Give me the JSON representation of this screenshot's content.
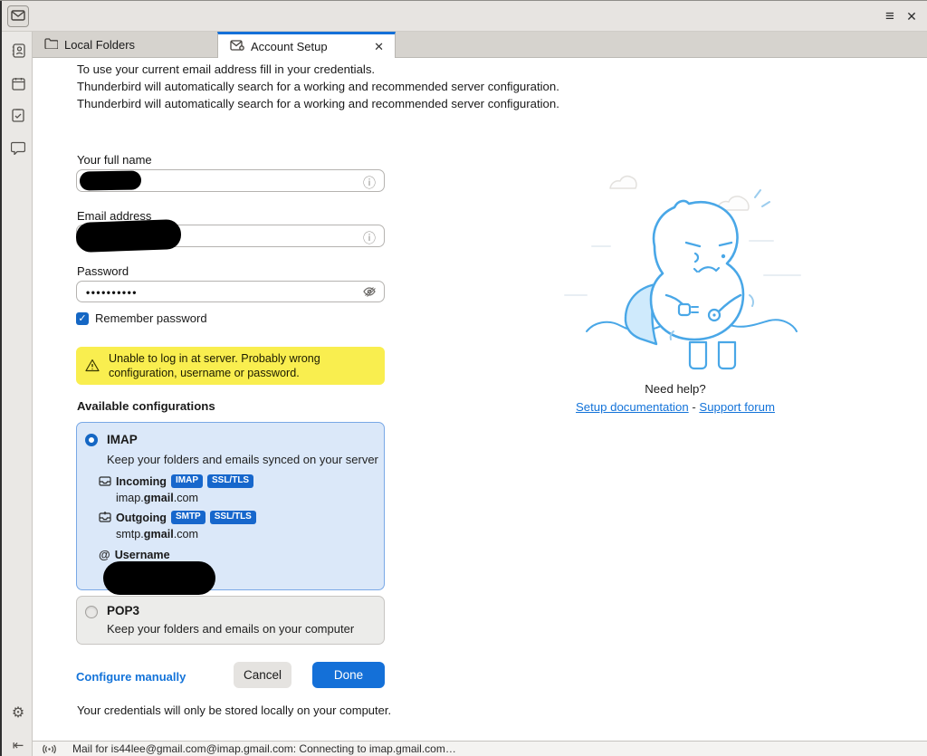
{
  "window": {
    "menu_icon": "≡",
    "close_icon": "✕"
  },
  "tabs": {
    "local_folders": "Local Folders",
    "account_setup": "Account Setup",
    "close": "✕"
  },
  "intro": {
    "line1": "To use your current email address fill in your credentials.",
    "line2": "Thunderbird will automatically search for a working and recommended server configuration.",
    "line3": "Thunderbird will automatically search for a working and recommended server configuration."
  },
  "form": {
    "full_name_label": "Your full name",
    "email_label": "Email address",
    "password_label": "Password",
    "password_mask": "••••••••••",
    "remember_label": "Remember password",
    "check_glyph": "✓"
  },
  "warning": {
    "line1": "Unable to log in at server. Probably wrong",
    "line2": "configuration, username or password."
  },
  "configs": {
    "title": "Available configurations",
    "imap": {
      "name": "IMAP",
      "desc": "Keep your folders and emails synced on your server",
      "incoming_label": "Incoming",
      "incoming_badges": [
        "IMAP",
        "SSL/TLS"
      ],
      "incoming_host": {
        "pre": "imap.",
        "bold": "gmail",
        "post": ".com"
      },
      "outgoing_label": "Outgoing",
      "outgoing_badges": [
        "SMTP",
        "SSL/TLS"
      ],
      "outgoing_host": {
        "pre": "smtp.",
        "bold": "gmail",
        "post": ".com"
      },
      "username_label": "Username",
      "at_glyph": "@"
    },
    "pop3": {
      "name": "POP3",
      "desc": "Keep your folders and emails on your computer"
    }
  },
  "actions": {
    "configure_manually": "Configure manually",
    "cancel": "Cancel",
    "done": "Done"
  },
  "help": {
    "title": "Need help?",
    "doc_link": "Setup documentation",
    "separator": "-",
    "forum_link": "Support forum"
  },
  "footer_note": "Your credentials will only be stored locally on your computer.",
  "statusbar": {
    "text": "Mail for is44lee@gmail.com@imap.gmail.com: Connecting to imap.gmail.com…"
  },
  "colors": {
    "accent": "#1470d8",
    "badge_blue": "#1767cc",
    "warning_bg": "#f9ee4f",
    "imap_bg": "#dbe8f9",
    "imap_border": "#79a8e6"
  }
}
